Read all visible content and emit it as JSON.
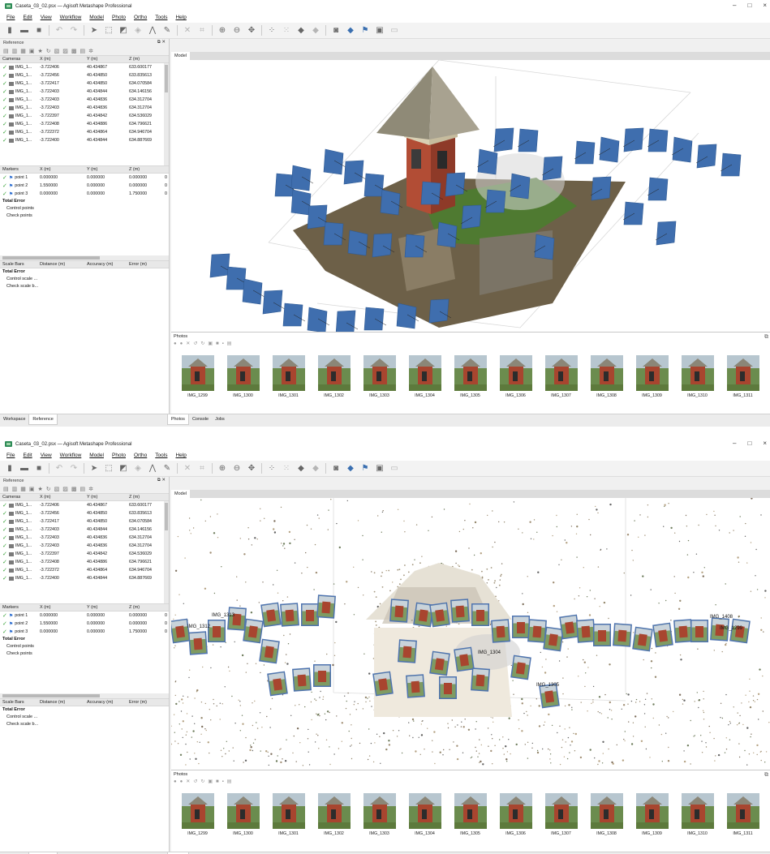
{
  "window": {
    "title": "Caseta_03_02.psx — Agisoft Metashape Professional",
    "controls": {
      "minimize": "–",
      "maximize": "□",
      "close": "×"
    }
  },
  "menu": [
    "File",
    "Edit",
    "View",
    "Workflow",
    "Model",
    "Photo",
    "Ortho",
    "Tools",
    "Help"
  ],
  "toolbar_icons": [
    "new-file-icon",
    "open-folder-icon",
    "save-icon",
    "undo-icon",
    "redo-icon",
    "pointer-icon",
    "rect-select-icon",
    "navigate-icon",
    "magic-wand-icon",
    "lasso-icon",
    "brush-icon",
    "delete-icon",
    "crop-icon",
    "zoom-in-icon",
    "zoom-out-icon",
    "move-icon",
    "point-cloud-icon",
    "dense-cloud-icon",
    "mesh-icon",
    "texture-icon",
    "camera-icon",
    "marker-icon",
    "flag-icon",
    "image-icon",
    "grid-icon"
  ],
  "reference_panel": {
    "title": "Reference",
    "cameras_header": [
      "Cameras",
      "X (m)",
      "Y (m)",
      "Z (m)"
    ],
    "cameras": [
      {
        "label": "IMG_1...",
        "x": "-3.722406",
        "y": "40.434867",
        "z": "633.600177"
      },
      {
        "label": "IMG_1...",
        "x": "-3.722456",
        "y": "40.434850",
        "z": "633.835613"
      },
      {
        "label": "IMG_1...",
        "x": "-3.722417",
        "y": "40.434850",
        "z": "634.070584"
      },
      {
        "label": "IMG_1...",
        "x": "-3.722403",
        "y": "40.434844",
        "z": "634.146156"
      },
      {
        "label": "IMG_1...",
        "x": "-3.722403",
        "y": "40.434836",
        "z": "634.312704"
      },
      {
        "label": "IMG_1...",
        "x": "-3.722403",
        "y": "40.434836",
        "z": "634.312704"
      },
      {
        "label": "IMG_1...",
        "x": "-3.722397",
        "y": "40.434842",
        "z": "634.536029"
      },
      {
        "label": "IMG_1...",
        "x": "-3.722408",
        "y": "40.434886",
        "z": "634.796621"
      },
      {
        "label": "IMG_1...",
        "x": "-3.722372",
        "y": "40.434864",
        "z": "634.946704"
      },
      {
        "label": "IMG_1...",
        "x": "-3.722400",
        "y": "40.434844",
        "z": "634.887669"
      }
    ],
    "markers_header": [
      "Markers",
      "X (m)",
      "Y (m)",
      "Z (m)"
    ],
    "markers": [
      {
        "label": "point 1",
        "x": "0.000000",
        "y": "0.000000",
        "z": "0.000000"
      },
      {
        "label": "point 2",
        "x": "1.550000",
        "y": "0.000000",
        "z": "0.000000"
      },
      {
        "label": "point 3",
        "x": "0.000000",
        "y": "0.000000",
        "z": "1.750000"
      }
    ],
    "markers_extra_col": "0",
    "total_error": "Total Error",
    "control_points": "Control points",
    "check_points": "Check points",
    "scalebars_header": [
      "Scale Bars",
      "Distance (m)",
      "Accuracy (m)",
      "Error (m)"
    ],
    "control_scale": "Control scale ...",
    "check_scale": "Check scale b..."
  },
  "bottom_tabs_left": [
    "Workspace",
    "Reference"
  ],
  "bottom_tabs_right": [
    "Photos",
    "Console",
    "Jobs"
  ],
  "model_tab": "Model",
  "photos_title": "Photos",
  "photos": [
    "IMG_1299",
    "IMG_1300",
    "IMG_1301",
    "IMG_1302",
    "IMG_1303",
    "IMG_1304",
    "IMG_1305",
    "IMG_1306",
    "IMG_1307",
    "IMG_1308",
    "IMG_1309",
    "IMG_1310",
    "IMG_1311"
  ],
  "model_labels_view2": [
    "IMG_1408",
    "IMG_1305",
    "IMG_1304",
    "IMG_1299",
    "IMG_1312",
    "IMG_1313"
  ],
  "colors": {
    "camera_plane": "#3f6eae",
    "brick": "#a0412a",
    "grass": "#5c7d3a",
    "roof": "#8a8474",
    "check": "#3ba33b"
  }
}
